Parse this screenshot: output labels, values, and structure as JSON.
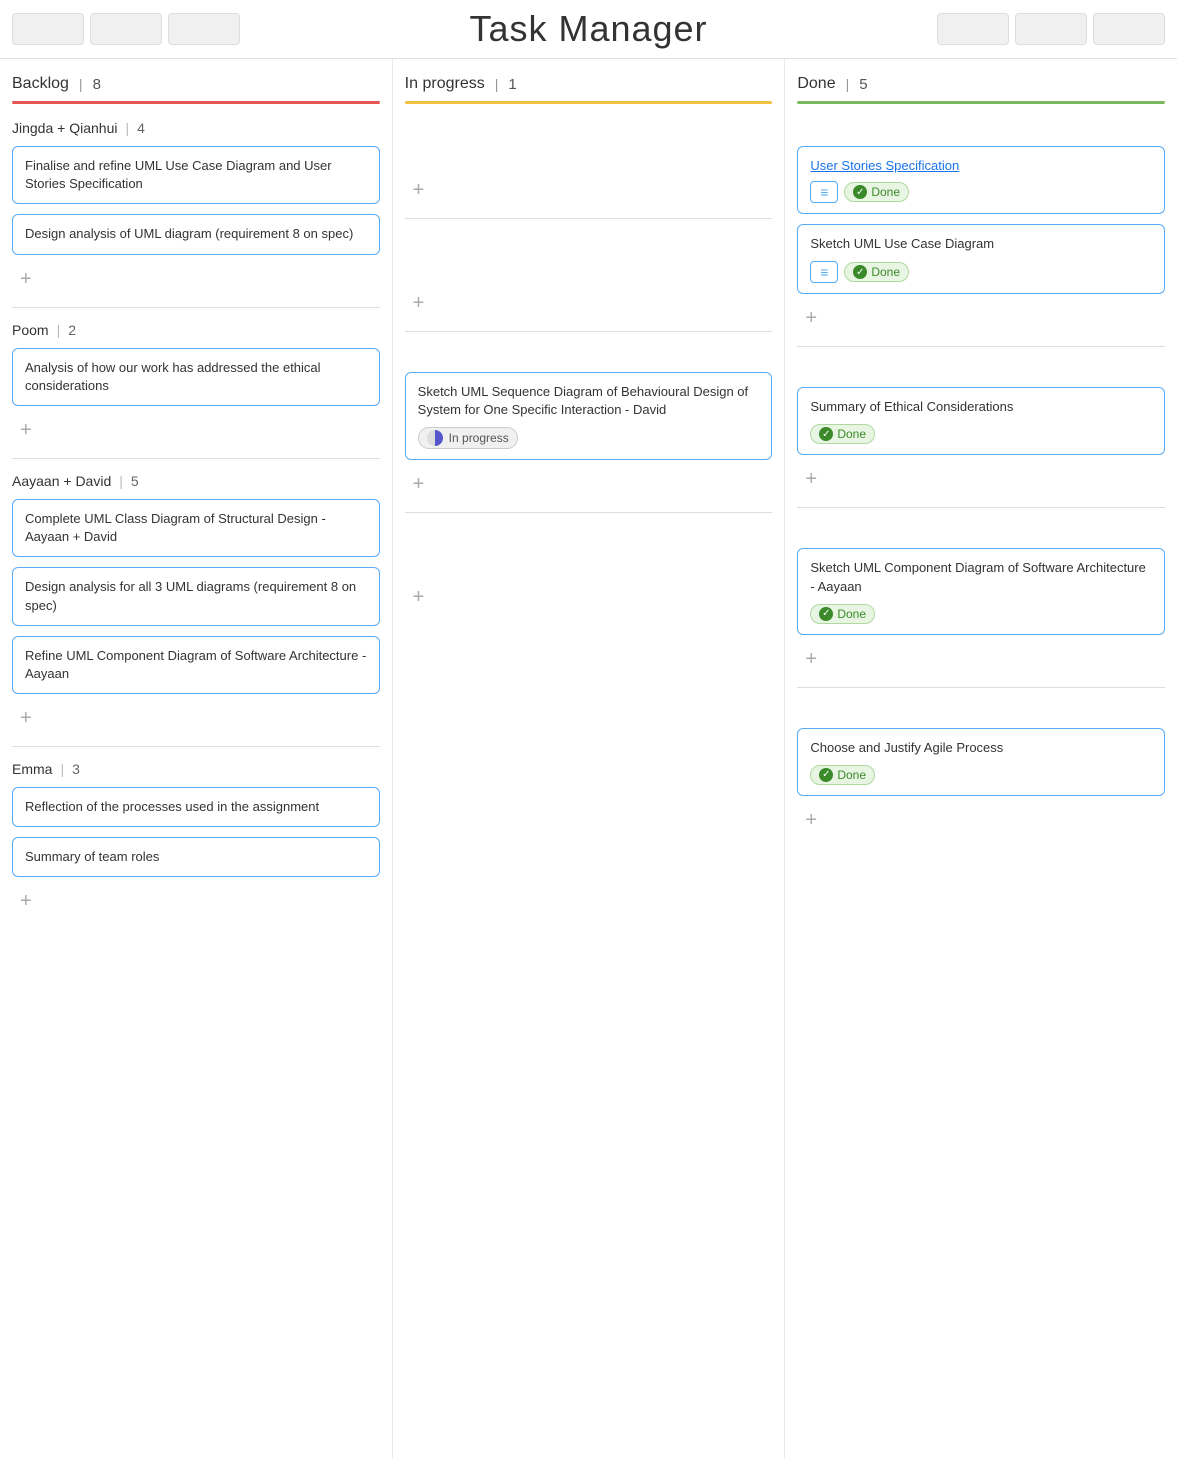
{
  "header": {
    "title": "Task Manager"
  },
  "columns": [
    {
      "id": "backlog",
      "title": "Backlog",
      "count": 8,
      "lineColor": "line-red"
    },
    {
      "id": "inprogress",
      "title": "In progress",
      "count": 1,
      "lineColor": "line-yellow"
    },
    {
      "id": "done",
      "title": "Done",
      "count": 5,
      "lineColor": "line-green"
    }
  ],
  "sections": [
    {
      "id": "jingda-qianhui",
      "label": "Jingda + Qianhui",
      "count": 4,
      "backlog": [
        {
          "id": "card-1",
          "text": "Finalise and refine UML Use Case Diagram and User Stories Specification"
        },
        {
          "id": "card-2",
          "text": "Design analysis of UML diagram (requirement 8 on spec)"
        }
      ],
      "inprogress": [],
      "done": [
        {
          "id": "card-d1",
          "title": "User Stories Specification",
          "isLink": true,
          "showMenu": true,
          "badge": "Done"
        },
        {
          "id": "card-d2",
          "title": "Sketch UML Use Case Diagram",
          "isLink": false,
          "showMenu": true,
          "badge": "Done"
        }
      ]
    },
    {
      "id": "poom",
      "label": "Poom",
      "count": 2,
      "backlog": [
        {
          "id": "card-p1",
          "text": "Analysis of how our work has addressed the ethical considerations"
        }
      ],
      "inprogress": [],
      "done": [
        {
          "id": "card-pd1",
          "title": "Summary of Ethical Considerations",
          "isLink": false,
          "showMenu": false,
          "badge": "Done"
        }
      ]
    },
    {
      "id": "aayaan-david",
      "label": "Aayaan + David",
      "count": 5,
      "backlog": [
        {
          "id": "card-a1",
          "text": "Complete UML Class Diagram of Structural Design - Aayaan + David"
        },
        {
          "id": "card-a2",
          "text": "Design analysis for all 3 UML diagrams (requirement 8 on spec)"
        },
        {
          "id": "card-a3",
          "text": "Refine UML Component Diagram of Software Architecture - Aayaan"
        }
      ],
      "inprogress": [
        {
          "id": "card-ai1",
          "text": "Sketch UML Sequence Diagram of Behavioural Design of System for One Specific Interaction - David",
          "badge": "In progress"
        }
      ],
      "done": [
        {
          "id": "card-ad1",
          "title": "Sketch UML Component Diagram of Software Architecture - Aayaan",
          "isLink": false,
          "showMenu": false,
          "badge": "Done"
        }
      ]
    },
    {
      "id": "emma",
      "label": "Emma",
      "count": 3,
      "backlog": [
        {
          "id": "card-e1",
          "text": "Reflection of the processes used in the assignment"
        },
        {
          "id": "card-e2",
          "text": "Summary of team roles"
        }
      ],
      "inprogress": [],
      "done": [
        {
          "id": "card-ed1",
          "title": "Choose and Justify Agile Process",
          "isLink": false,
          "showMenu": false,
          "badge": "Done"
        }
      ]
    }
  ],
  "labels": {
    "done": "Done",
    "inprogress": "In progress",
    "add": "+",
    "menu": "≡"
  }
}
